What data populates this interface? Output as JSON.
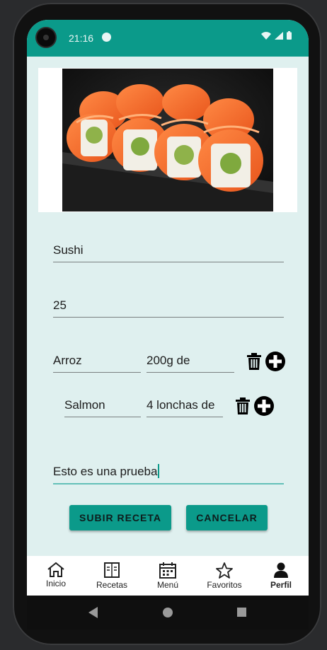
{
  "status_bar": {
    "time": "21:16"
  },
  "recipe": {
    "name": "Sushi",
    "time_value": "25",
    "ingredients": [
      {
        "name": "Arroz",
        "quantity": "200g de"
      },
      {
        "name": "Salmon",
        "quantity": "4 lonchas de"
      }
    ],
    "description": "Esto es una prueba"
  },
  "actions": {
    "submit": "SUBIR RECETA",
    "cancel": "CANCELAR"
  },
  "bottom_nav": {
    "items": [
      {
        "label": "Inicio",
        "icon": "home-icon"
      },
      {
        "label": "Recetas",
        "icon": "recipe-book-icon"
      },
      {
        "label": "Menú",
        "icon": "calendar-icon"
      },
      {
        "label": "Favoritos",
        "icon": "star-icon"
      },
      {
        "label": "Perfil",
        "icon": "person-icon"
      }
    ],
    "selected": "Perfil"
  },
  "colors": {
    "accent": "#0b9a8a",
    "background": "#dff0ef",
    "fab_icon": "#000000"
  }
}
